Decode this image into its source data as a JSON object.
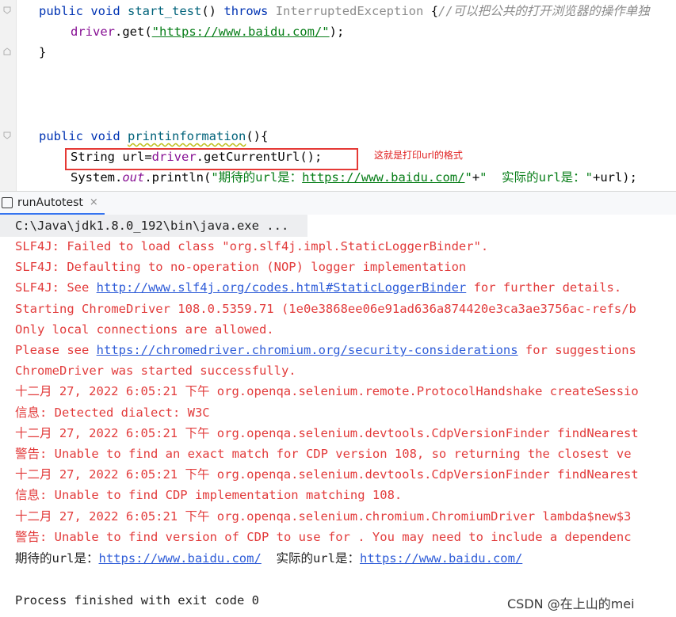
{
  "editor": {
    "line1": {
      "kw1": "public",
      "kw2": "void",
      "method": "start_test",
      "parens": "()",
      "throws": "throws",
      "exception": "InterruptedException",
      "brace": "{",
      "comment": "//可以把公共的打开浏览器的操作单独"
    },
    "line2": {
      "driver": "driver",
      "get": ".get(",
      "url": "\"https://www.baidu.com/\"",
      "end": ");"
    },
    "line3": {
      "brace": "}"
    },
    "line4": {
      "kw1": "public",
      "kw2": "void",
      "method": "printinformation",
      "rest": "(){"
    },
    "line5": {
      "type": "String",
      "var": " url=",
      "driver": "driver",
      "call": ".getCurrentUrl();"
    },
    "line6": {
      "system": "System.",
      "out": "out",
      "println": ".println(",
      "str1": "\"期待的url是：",
      "str1url": "https://www.baidu.com/",
      "str1end": "\"",
      "plus": "+",
      "str2": "\"  实际的url是：\"",
      "rest": "+url);"
    },
    "annotation": "这就是打印url的格式"
  },
  "run_panel": {
    "tab_label": "runAutotest",
    "close_glyph": "×",
    "icon": "run-config-icon"
  },
  "console": {
    "cmd": "C:\\Java\\jdk1.8.0_192\\bin\\java.exe ...",
    "lines": [
      {
        "pre": "SLF4J: Failed to load class \"org.slf4j.impl.StaticLoggerBinder\"."
      },
      {
        "pre": "SLF4J: Defaulting to no-operation (NOP) logger implementation"
      },
      {
        "pre": "SLF4J: See ",
        "link": "http://www.slf4j.org/codes.html#StaticLoggerBinder",
        "post": " for further details."
      },
      {
        "pre": "Starting ChromeDriver 108.0.5359.71 (1e0e3868ee06e91ad636a874420e3ca3ae3756ac-refs/b"
      },
      {
        "pre": "Only local connections are allowed."
      },
      {
        "pre": "Please see ",
        "link": "https://chromedriver.chromium.org/security-considerations",
        "post": " for suggestions"
      },
      {
        "pre": "ChromeDriver was started successfully."
      },
      {
        "pre": "十二月 27, 2022 6:05:21 下午 org.openqa.selenium.remote.ProtocolHandshake createSessio"
      },
      {
        "pre": "信息: Detected dialect: W3C"
      },
      {
        "pre": "十二月 27, 2022 6:05:21 下午 org.openqa.selenium.devtools.CdpVersionFinder findNearest"
      },
      {
        "pre": "警告: Unable to find an exact match for CDP version 108, so returning the closest ve"
      },
      {
        "pre": "十二月 27, 2022 6:05:21 下午 org.openqa.selenium.devtools.CdpVersionFinder findNearest"
      },
      {
        "pre": "信息: Unable to find CDP implementation matching 108."
      },
      {
        "pre": "十二月 27, 2022 6:05:21 下午 org.openqa.selenium.chromium.ChromiumDriver lambda$new$3"
      },
      {
        "pre": "警告: Unable to find version of CDP to use for . You may need to include a dependenc"
      }
    ],
    "result": {
      "label1": "期待的url是：",
      "url1": "https://www.baidu.com/",
      "label2": "  实际的url是：",
      "url2": "https://www.baidu.com/"
    },
    "exit": "Process finished with exit code 0"
  },
  "watermark": "CSDN @在上山的mei",
  "colors": {
    "error_text": "#e23b3b",
    "link": "#2f5dd8",
    "keyword": "#0033b3",
    "annotation_box": "#e53935"
  }
}
